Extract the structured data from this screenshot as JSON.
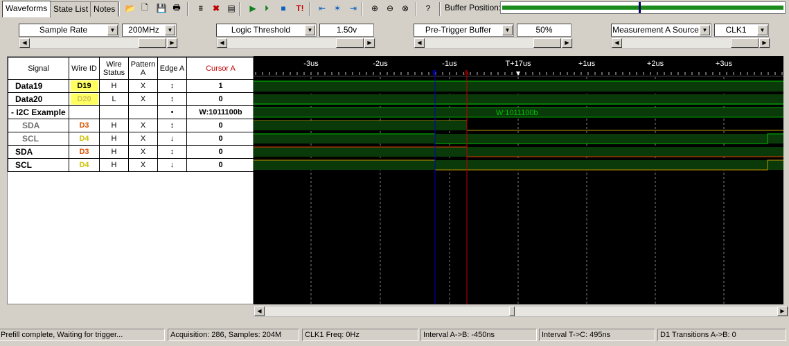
{
  "tabs": [
    {
      "label": "Waveforms",
      "active": true
    },
    {
      "label": "State List",
      "active": false
    },
    {
      "label": "Notes",
      "active": false
    }
  ],
  "toolbar": {
    "buttons": [
      {
        "name": "open-folder-icon",
        "glyph": "📂"
      },
      {
        "name": "new-file-icon",
        "glyph": "🗋"
      },
      {
        "name": "save-icon",
        "glyph": "💾"
      },
      {
        "name": "print-icon",
        "glyph": "🖶"
      },
      {
        "name": "bus-setup-icon",
        "glyph": "⩩"
      },
      {
        "name": "delete-bus-icon",
        "glyph": "✖"
      },
      {
        "name": "signal-settings-icon",
        "glyph": "▤"
      },
      {
        "name": "run-icon",
        "glyph": "▶"
      },
      {
        "name": "single-run-icon",
        "glyph": "⏵"
      },
      {
        "name": "stop-icon",
        "glyph": "■"
      },
      {
        "name": "trigger-icon",
        "glyph": "T!"
      },
      {
        "name": "goto-start-icon",
        "glyph": "⇤"
      },
      {
        "name": "goto-trigger-icon",
        "glyph": "✶"
      },
      {
        "name": "goto-end-icon",
        "glyph": "⇥"
      },
      {
        "name": "zoom-in-icon",
        "glyph": "⊕"
      },
      {
        "name": "zoom-out-icon",
        "glyph": "⊖"
      },
      {
        "name": "zoom-fit-icon",
        "glyph": "⊗"
      },
      {
        "name": "help-icon",
        "glyph": "?"
      }
    ],
    "buffer_position_label": "Buffer Position:",
    "buffer_position_fraction": 0.49
  },
  "controls": [
    {
      "name": "sample-rate",
      "label": "Sample Rate",
      "value": "200MHz"
    },
    {
      "name": "logic-threshold",
      "label": "Logic Threshold",
      "value": "1.50v"
    },
    {
      "name": "pre-trigger-buffer",
      "label": "Pre-Trigger Buffer",
      "value": "50%"
    },
    {
      "name": "measurement-a-source",
      "label": "Measurement A Source",
      "value": "CLK1"
    }
  ],
  "table": {
    "headers": [
      "Signal",
      "Wire ID",
      "Wire Status",
      "Pattern A",
      "Edge A",
      "Cursor A"
    ],
    "rows": [
      {
        "signal": "Data19",
        "wire_id": "D19",
        "status": "H",
        "pattern": "X",
        "edge": "↕",
        "cursor": "1"
      },
      {
        "signal": "Data20",
        "wire_id": "D20",
        "status": "L",
        "pattern": "X",
        "edge": "↕",
        "cursor": "0"
      },
      {
        "signal": "- I2C Example",
        "wire_id": "",
        "status": "",
        "pattern": "",
        "edge": "•",
        "cursor": "W:1011100b"
      },
      {
        "signal": "SDA",
        "wire_id": "D3",
        "status": "H",
        "pattern": "X",
        "edge": "↕",
        "cursor": "0"
      },
      {
        "signal": "SCL",
        "wire_id": "D4",
        "status": "H",
        "pattern": "X",
        "edge": "↓",
        "cursor": "0"
      },
      {
        "signal": "SDA",
        "wire_id": "D3",
        "status": "H",
        "pattern": "X",
        "edge": "↕",
        "cursor": "0"
      },
      {
        "signal": "SCL",
        "wire_id": "D4",
        "status": "H",
        "pattern": "X",
        "edge": "↓",
        "cursor": "0"
      }
    ]
  },
  "waveform": {
    "time_labels": [
      "-3us",
      "-2us",
      "-1us",
      "T+17us",
      "+1us",
      "+2us",
      "+3us"
    ],
    "cursor_b_label": "B",
    "cursor_a_label": "A",
    "bus_decode": "W:1011100b",
    "colors": {
      "high": "#00c000",
      "bus": "#00a000",
      "cursor_a": "#c00000",
      "cursor_b": "#0000c0",
      "grid": "#808080"
    }
  },
  "status": [
    "Prefill complete, Waiting for trigger...",
    "Acquisition: 286, Samples: 204M",
    "CLK1 Freq: 0Hz",
    "Interval A->B: -450ns",
    "Interval T->C: 495ns",
    "D1 Transitions A->B: 0"
  ]
}
